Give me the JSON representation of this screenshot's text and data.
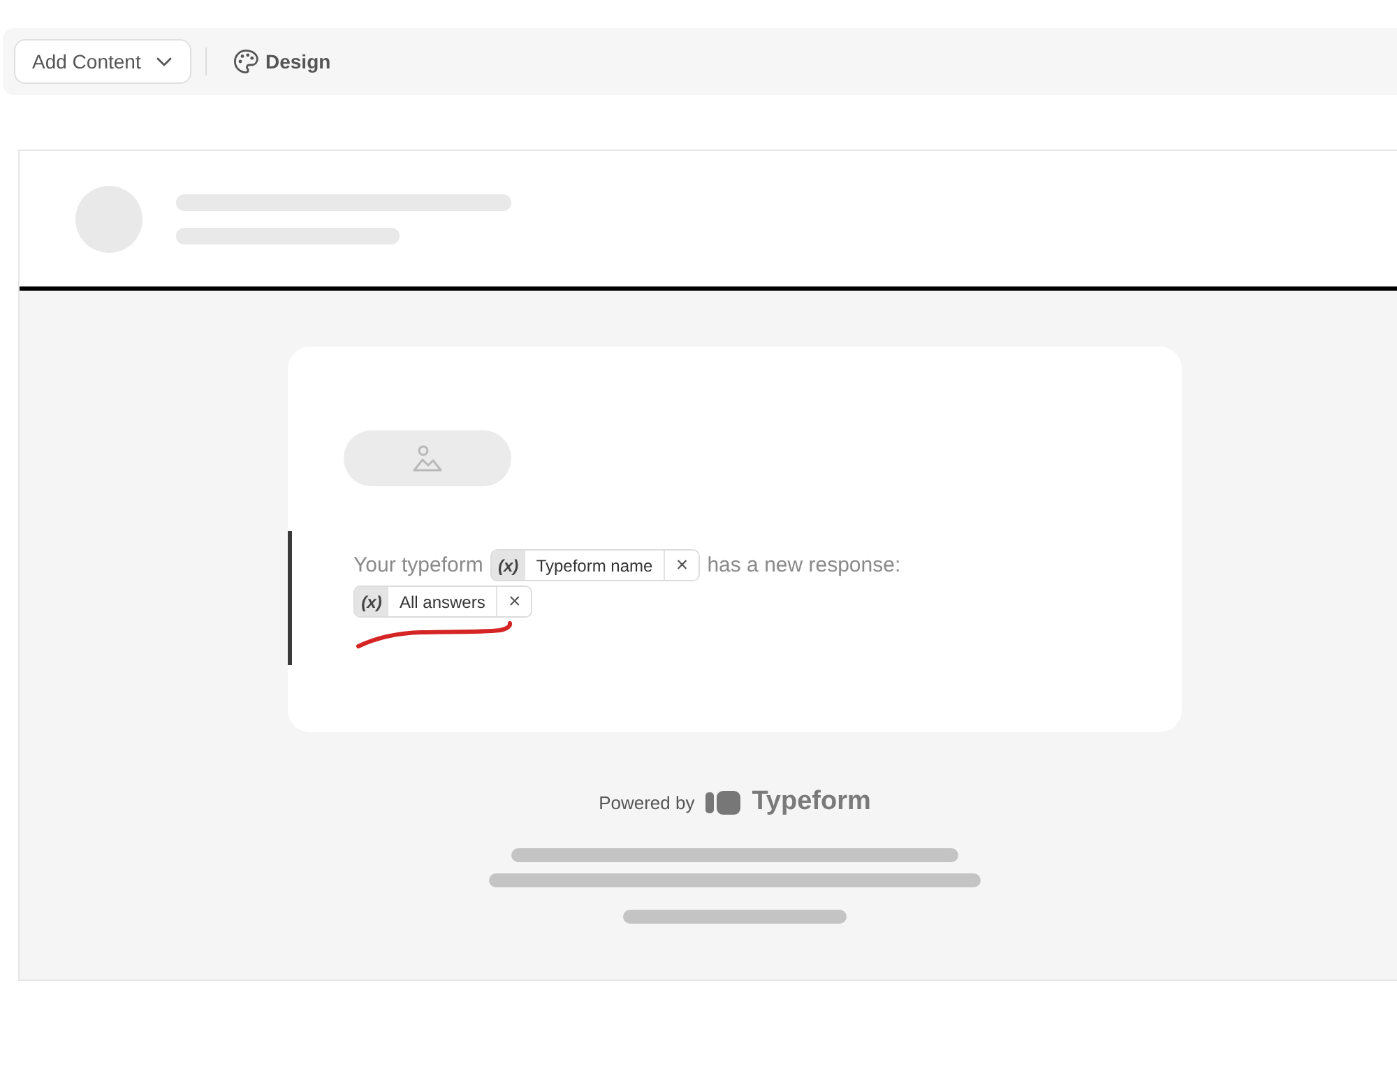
{
  "toolbar": {
    "add_content": {
      "label": "Add Content"
    },
    "design": {
      "label": "Design"
    }
  },
  "email": {
    "message": {
      "selected": true,
      "lines": [
        [
          {
            "kind": "text",
            "text": "Your typeform"
          },
          {
            "kind": "variable",
            "symbol": "(x)",
            "label": "Typeform name",
            "remove": "×"
          },
          {
            "kind": "text",
            "text": "has a new response:"
          }
        ],
        [
          {
            "kind": "variable",
            "symbol": "(x)",
            "label": "All answers",
            "remove": "×"
          }
        ]
      ]
    },
    "footer": {
      "powered_by": "Powered by",
      "brand": "Typeform"
    }
  }
}
